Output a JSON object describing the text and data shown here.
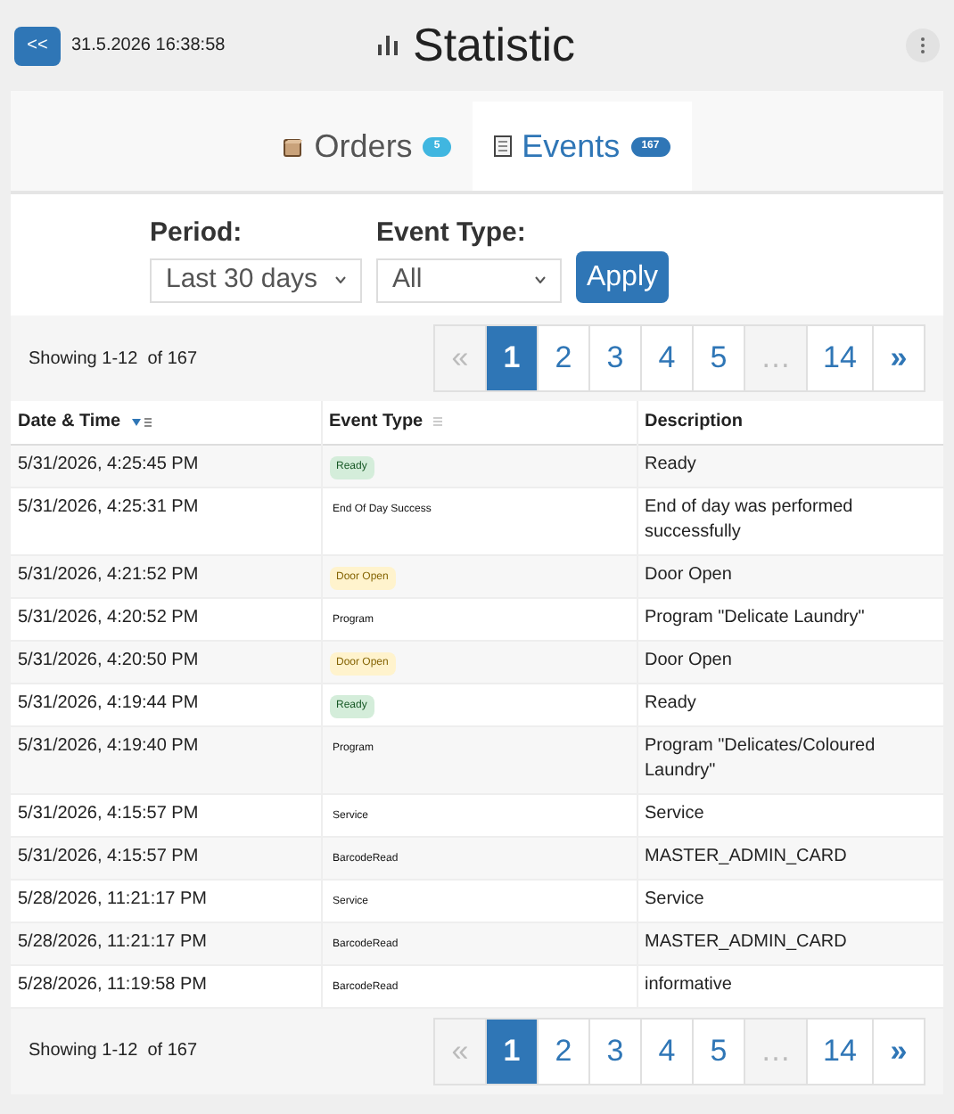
{
  "header": {
    "back_button": "<<",
    "datetime": "31.5.2026 16:38:58",
    "title": "Statistic"
  },
  "tabs": [
    {
      "label": "Orders",
      "badge": "5",
      "selected": false
    },
    {
      "label": "Events",
      "badge": "167",
      "selected": true
    }
  ],
  "filters": {
    "period": {
      "label": "Period:",
      "value": "Last 30 days"
    },
    "event_type": {
      "label": "Event Type:",
      "value": "All"
    },
    "apply": "Apply"
  },
  "pagination_top": {
    "summary": "Showing 1-12  of 167",
    "pages": [
      {
        "label": "«",
        "kind": "prev",
        "disabled": true,
        "selected": false
      },
      {
        "label": "1",
        "kind": "page",
        "disabled": false,
        "selected": true
      },
      {
        "label": "2",
        "kind": "page",
        "disabled": false,
        "selected": false
      },
      {
        "label": "3",
        "kind": "page",
        "disabled": false,
        "selected": false
      },
      {
        "label": "4",
        "kind": "page",
        "disabled": false,
        "selected": false
      },
      {
        "label": "5",
        "kind": "page",
        "disabled": false,
        "selected": false
      },
      {
        "label": "…",
        "kind": "gap",
        "disabled": true,
        "selected": false
      },
      {
        "label": "14",
        "kind": "page",
        "disabled": false,
        "selected": false
      },
      {
        "label": "»",
        "kind": "next",
        "disabled": false,
        "selected": false
      }
    ]
  },
  "table": {
    "columns": [
      {
        "label": "Date & Time"
      },
      {
        "label": "Event Type"
      },
      {
        "label": "Description"
      }
    ],
    "rows": [
      {
        "datetime": "5/31/2026, 4:25:45 PM",
        "event_type": "Ready",
        "kind": "success",
        "description": "Ready"
      },
      {
        "datetime": "5/31/2026, 4:25:31 PM",
        "event_type": "End Of Day Success",
        "kind": "plain",
        "description": "End of day was performed successfully"
      },
      {
        "datetime": "5/31/2026, 4:21:52 PM",
        "event_type": "Door Open",
        "kind": "warning",
        "description": "Door Open"
      },
      {
        "datetime": "5/31/2026, 4:20:52 PM",
        "event_type": "Program",
        "kind": "plain",
        "description": "Program \"Delicate Laundry\""
      },
      {
        "datetime": "5/31/2026, 4:20:50 PM",
        "event_type": "Door Open",
        "kind": "warning",
        "description": "Door Open"
      },
      {
        "datetime": "5/31/2026, 4:19:44 PM",
        "event_type": "Ready",
        "kind": "success",
        "description": "Ready"
      },
      {
        "datetime": "5/31/2026, 4:19:40 PM",
        "event_type": "Program",
        "kind": "plain",
        "description": "Program \"Delicates/Coloured Laundry\""
      },
      {
        "datetime": "5/31/2026, 4:15:57 PM",
        "event_type": "Service",
        "kind": "plain",
        "description": "Service"
      },
      {
        "datetime": "5/31/2026, 4:15:57 PM",
        "event_type": "BarcodeRead",
        "kind": "plain",
        "description": "MASTER_ADMIN_CARD"
      },
      {
        "datetime": "5/28/2026, 11:21:17 PM",
        "event_type": "Service",
        "kind": "plain",
        "description": "Service"
      },
      {
        "datetime": "5/28/2026, 11:21:17 PM",
        "event_type": "BarcodeRead",
        "kind": "plain",
        "description": "MASTER_ADMIN_CARD"
      },
      {
        "datetime": "5/28/2026, 11:19:58 PM",
        "event_type": "BarcodeRead",
        "kind": "plain",
        "description": "informative"
      }
    ]
  },
  "pagination_bottom": {
    "summary": "Showing 1-12  of 167",
    "pages": [
      {
        "label": "«",
        "kind": "prev",
        "disabled": true,
        "selected": false
      },
      {
        "label": "1",
        "kind": "page",
        "disabled": false,
        "selected": true
      },
      {
        "label": "2",
        "kind": "page",
        "disabled": false,
        "selected": false
      },
      {
        "label": "3",
        "kind": "page",
        "disabled": false,
        "selected": false
      },
      {
        "label": "4",
        "kind": "page",
        "disabled": false,
        "selected": false
      },
      {
        "label": "5",
        "kind": "page",
        "disabled": false,
        "selected": false
      },
      {
        "label": "…",
        "kind": "gap",
        "disabled": true,
        "selected": false
      },
      {
        "label": "14",
        "kind": "page",
        "disabled": false,
        "selected": false
      },
      {
        "label": "»",
        "kind": "next",
        "disabled": false,
        "selected": false
      }
    ]
  }
}
